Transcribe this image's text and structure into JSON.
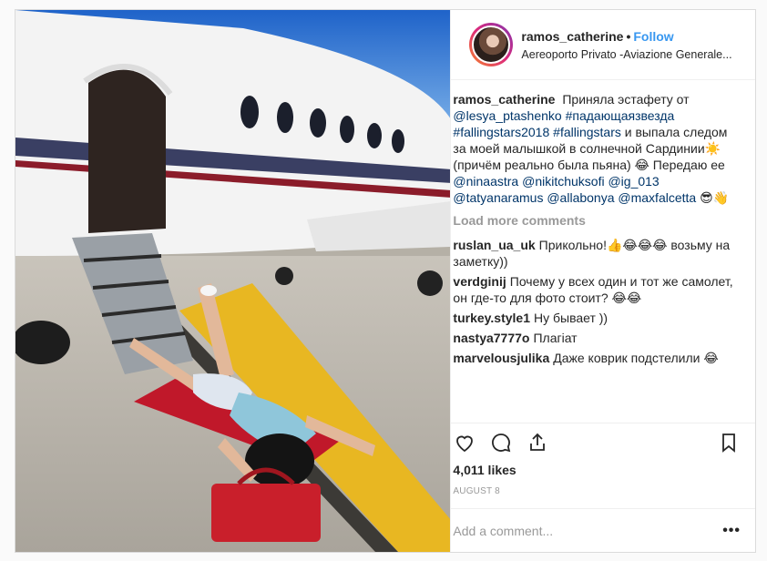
{
  "post": {
    "username": "ramos_catherine",
    "separator": "•",
    "follow_label": "Follow",
    "location": "Aereoporto Privato -Aviazione Generale...",
    "caption": {
      "username": "ramos_catherine",
      "text_1": "Приняла эстафету от",
      "tag_1": "@lesya_ptashenko",
      "tag_2": "#падающаязвезда",
      "tag_3": "#fallingstars2018",
      "tag_4": "#fallingstars",
      "text_2": "и выпала следом за моей малышкой в солнечной Сардинии☀️ (причём реально была пьяна) 😂 Передаю ее",
      "tag_5": "@ninaastra",
      "tag_6": "@nikitchuksofi",
      "tag_7": "@ig_013",
      "tag_8": "@tatyanaramus",
      "tag_9": "@allabonya",
      "tag_10": "@maxfalcetta",
      "text_3": "😎👋"
    },
    "load_more_label": "Load more comments",
    "comments": [
      {
        "user": "ruslan_ua_uk",
        "text": "Прикольно!👍😂😂😂 возьму на заметку))"
      },
      {
        "user": "verdginij",
        "text": "Почему у всех один и тот же самолет, он где-то для фото стоит? 😂😂"
      },
      {
        "user": "turkey.style1",
        "text": "Ну бывает ))"
      },
      {
        "user": "nastya7777o",
        "text": "Плагіат"
      },
      {
        "user": "marvelousjulika",
        "text": "Даже коврик подстелили 😂"
      }
    ],
    "likes": "4,011 likes",
    "date": "AUGUST 8",
    "add_comment_placeholder": "Add a comment...",
    "more_options": "•••",
    "icons": [
      "heart-icon",
      "comment-icon",
      "share-icon",
      "bookmark-icon"
    ],
    "accent_color": "#3897f0"
  }
}
